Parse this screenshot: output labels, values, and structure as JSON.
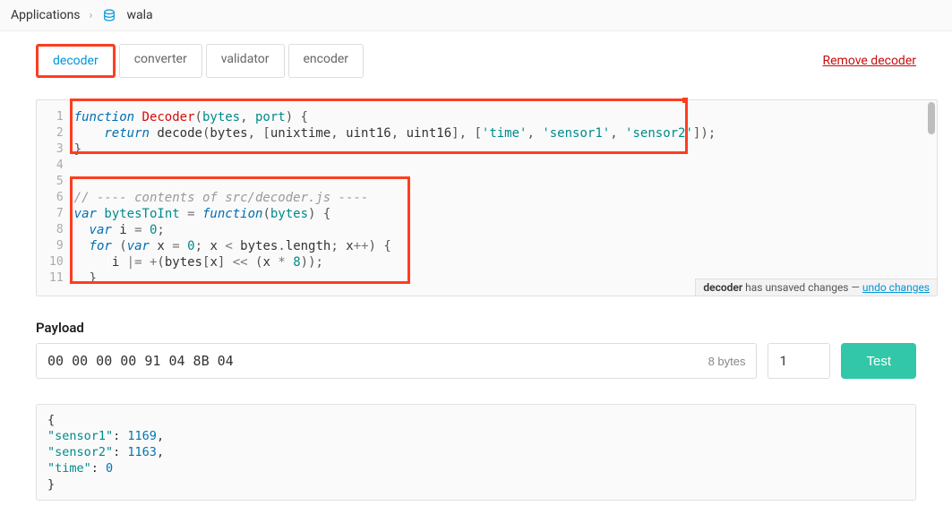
{
  "breadcrumb": {
    "root": "Applications",
    "app_name": "wala"
  },
  "tabs": [
    {
      "label": "decoder",
      "active": true
    },
    {
      "label": "converter",
      "active": false
    },
    {
      "label": "validator",
      "active": false
    },
    {
      "label": "encoder",
      "active": false
    }
  ],
  "remove_link_label": "Remove decoder",
  "editor": {
    "line_count": 11,
    "code_lines": [
      {
        "tokens": [
          {
            "c": "kw",
            "t": "function "
          },
          {
            "c": "fn",
            "t": "Decoder"
          },
          {
            "c": "brkt",
            "t": "("
          },
          {
            "c": "var",
            "t": "bytes"
          },
          {
            "c": "brkt",
            "t": ", "
          },
          {
            "c": "var",
            "t": "port"
          },
          {
            "c": "brkt",
            "t": ") {"
          }
        ]
      },
      {
        "tokens": [
          {
            "c": "",
            "t": "    "
          },
          {
            "c": "kw",
            "t": "return"
          },
          {
            "c": "",
            "t": " decode"
          },
          {
            "c": "brkt",
            "t": "("
          },
          {
            "c": "",
            "t": "bytes"
          },
          {
            "c": "brkt",
            "t": ", ["
          },
          {
            "c": "",
            "t": "unixtime"
          },
          {
            "c": "brkt",
            "t": ", "
          },
          {
            "c": "",
            "t": "uint16"
          },
          {
            "c": "brkt",
            "t": ", "
          },
          {
            "c": "",
            "t": "uint16"
          },
          {
            "c": "brkt",
            "t": "], ["
          },
          {
            "c": "str",
            "t": "'time'"
          },
          {
            "c": "brkt",
            "t": ", "
          },
          {
            "c": "str",
            "t": "'sensor1'"
          },
          {
            "c": "brkt",
            "t": ", "
          },
          {
            "c": "str",
            "t": "'sensor2'"
          },
          {
            "c": "brkt",
            "t": "]);"
          }
        ]
      },
      {
        "tokens": [
          {
            "c": "brkt",
            "t": "}"
          }
        ]
      },
      {
        "tokens": []
      },
      {
        "tokens": []
      },
      {
        "tokens": [
          {
            "c": "comment",
            "t": "// ---- contents of src/decoder.js ----"
          }
        ]
      },
      {
        "tokens": [
          {
            "c": "kw",
            "t": "var"
          },
          {
            "c": "",
            "t": " "
          },
          {
            "c": "var",
            "t": "bytesToInt"
          },
          {
            "c": "",
            "t": " "
          },
          {
            "c": "op",
            "t": "="
          },
          {
            "c": "",
            "t": " "
          },
          {
            "c": "kw",
            "t": "function"
          },
          {
            "c": "brkt",
            "t": "("
          },
          {
            "c": "var",
            "t": "bytes"
          },
          {
            "c": "brkt",
            "t": ") {"
          }
        ]
      },
      {
        "tokens": [
          {
            "c": "",
            "t": "  "
          },
          {
            "c": "kw",
            "t": "var"
          },
          {
            "c": "",
            "t": " i "
          },
          {
            "c": "op",
            "t": "="
          },
          {
            "c": "",
            "t": " "
          },
          {
            "c": "num",
            "t": "0"
          },
          {
            "c": "brkt",
            "t": ";"
          }
        ]
      },
      {
        "tokens": [
          {
            "c": "",
            "t": "  "
          },
          {
            "c": "kw",
            "t": "for"
          },
          {
            "c": "",
            "t": " "
          },
          {
            "c": "brkt",
            "t": "("
          },
          {
            "c": "kw",
            "t": "var"
          },
          {
            "c": "",
            "t": " x "
          },
          {
            "c": "op",
            "t": "="
          },
          {
            "c": "",
            "t": " "
          },
          {
            "c": "num",
            "t": "0"
          },
          {
            "c": "brkt",
            "t": "; "
          },
          {
            "c": "",
            "t": "x "
          },
          {
            "c": "op",
            "t": "<"
          },
          {
            "c": "",
            "t": " bytes"
          },
          {
            "c": "brkt",
            "t": "."
          },
          {
            "c": "",
            "t": "length"
          },
          {
            "c": "brkt",
            "t": "; "
          },
          {
            "c": "",
            "t": "x"
          },
          {
            "c": "op",
            "t": "++"
          },
          {
            "c": "brkt",
            "t": ") {"
          }
        ]
      },
      {
        "tokens": [
          {
            "c": "",
            "t": "    "
          },
          {
            "c": "white",
            "t": "|"
          },
          {
            "c": "",
            "t": "i "
          },
          {
            "c": "op",
            "t": "|="
          },
          {
            "c": "",
            "t": " "
          },
          {
            "c": "op",
            "t": "+"
          },
          {
            "c": "brkt",
            "t": "("
          },
          {
            "c": "",
            "t": "bytes"
          },
          {
            "c": "brkt",
            "t": "["
          },
          {
            "c": "",
            "t": "x"
          },
          {
            "c": "brkt",
            "t": "] "
          },
          {
            "c": "op",
            "t": "<<"
          },
          {
            "c": "",
            "t": " "
          },
          {
            "c": "brkt",
            "t": "("
          },
          {
            "c": "",
            "t": "x "
          },
          {
            "c": "op",
            "t": "*"
          },
          {
            "c": "",
            "t": " "
          },
          {
            "c": "num",
            "t": "8"
          },
          {
            "c": "brkt",
            "t": "));"
          }
        ]
      },
      {
        "tokens": [
          {
            "c": "",
            "t": "  "
          },
          {
            "c": "brkt",
            "t": "}"
          }
        ]
      }
    ],
    "unsaved_bold": "decoder",
    "unsaved_text": " has unsaved changes — ",
    "unsaved_action": "undo changes"
  },
  "payload": {
    "label": "Payload",
    "value": "00 00 00 00 91 04 8B 04",
    "bytes_label": "8 bytes",
    "port_value": "1",
    "test_label": "Test"
  },
  "output": {
    "open": "{",
    "entries": [
      {
        "key": "\"sensor1\"",
        "value": "1169",
        "comma": ","
      },
      {
        "key": "\"sensor2\"",
        "value": "1163",
        "comma": ","
      },
      {
        "key": "\"time\"",
        "value": "0",
        "comma": ""
      }
    ],
    "close": "}"
  }
}
